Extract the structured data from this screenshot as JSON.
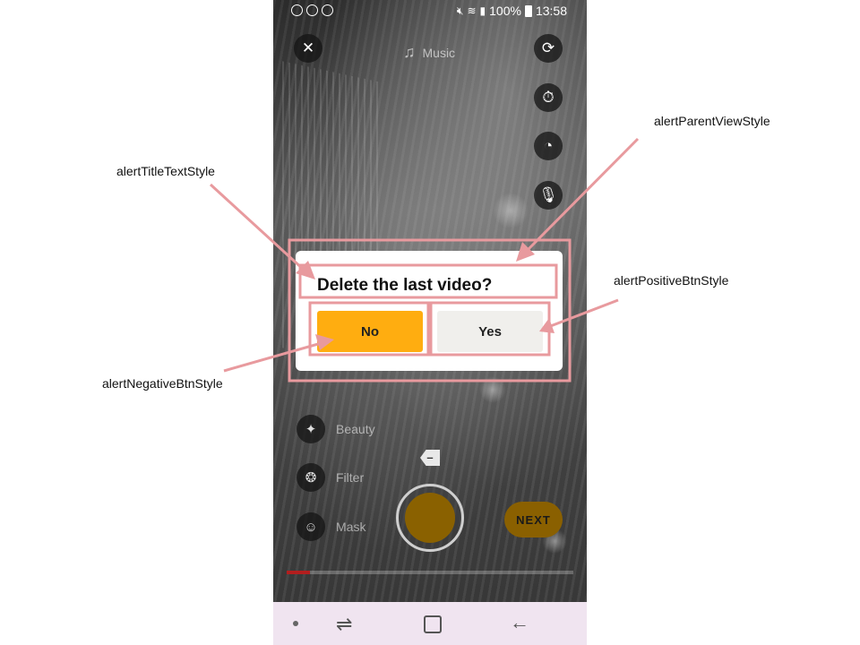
{
  "status_bar": {
    "battery": "100%",
    "time": "13:58"
  },
  "top_bar": {
    "music_label": "Music"
  },
  "side_tools": [
    {
      "label": "Beauty"
    },
    {
      "label": "Filter"
    },
    {
      "label": "Mask"
    }
  ],
  "next_button": "NEXT",
  "recording_progress": 0.08,
  "dialog": {
    "title": "Delete the last video?",
    "negative_label": "No",
    "positive_label": "Yes"
  },
  "annotations": {
    "parent_view": "alertParentViewStyle",
    "title_text": "alertTitleTextStyle",
    "positive_btn": "alertPositiveBtnStyle",
    "negative_btn": "alertNegativeBtnStyle",
    "color": "#e89a9e"
  },
  "colors": {
    "negative_button": "#ffad10",
    "positive_button": "#f0efec",
    "progress": "#b21e1e",
    "nav_bar": "#f0e4f0"
  }
}
